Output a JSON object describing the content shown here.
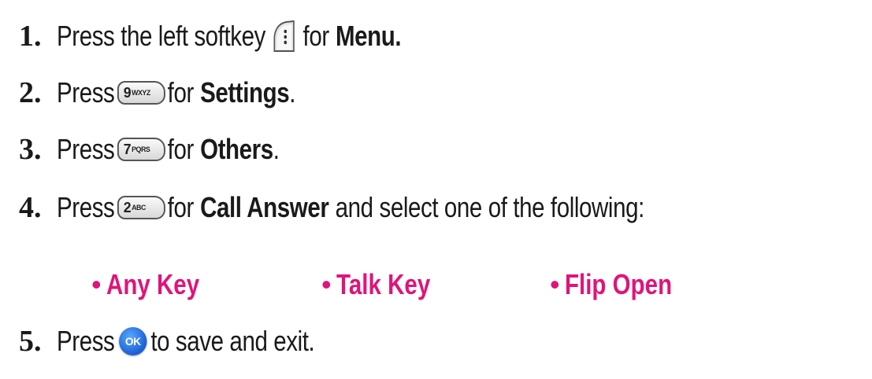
{
  "steps": [
    {
      "number": "1.",
      "before": "Press the left softkey",
      "key_icon": "left-softkey-icon",
      "after": "for",
      "bold": "Menu.",
      "tail": ""
    },
    {
      "number": "2.",
      "before": "Press",
      "key_icon": "key-9-icon",
      "key_digit": "9",
      "key_letters": "WXYZ",
      "after": "for",
      "bold": "Settings",
      "tail": "."
    },
    {
      "number": "3.",
      "before": "Press",
      "key_icon": "key-7-icon",
      "key_digit": "7",
      "key_letters": "PQRS",
      "after": "for",
      "bold": "Others",
      "tail": "."
    },
    {
      "number": "4.",
      "before": "Press",
      "key_icon": "key-2-icon",
      "key_digit": "2",
      "key_letters": "ABC",
      "after": "for",
      "bold": "Call Answer",
      "tail": "and select one of the following:"
    },
    {
      "number": "5.",
      "before": "Press",
      "key_icon": "ok-key-icon",
      "key_label": "OK",
      "after": "to save and exit.",
      "bold": "",
      "tail": ""
    }
  ],
  "options": [
    "Any Key",
    "Talk Key",
    "Flip Open"
  ],
  "colors": {
    "text": "#1a1a1a",
    "option_accent": "#e0147a",
    "ok_key": "#1a5fd6"
  }
}
